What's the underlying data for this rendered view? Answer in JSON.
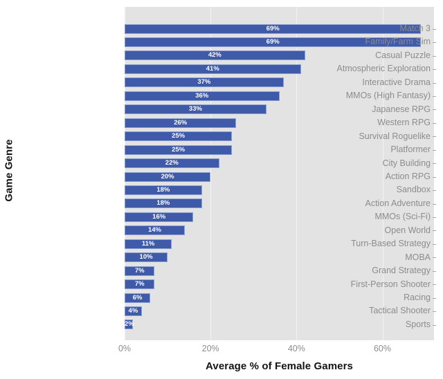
{
  "chart_data": {
    "type": "bar",
    "orientation": "horizontal",
    "title": "",
    "xlabel": "Average % of Female Gamers",
    "ylabel": "Game Genre",
    "xlim": [
      0,
      72
    ],
    "xticks": [
      "0%",
      "20%",
      "40%",
      "60%"
    ],
    "xtick_values": [
      0,
      20,
      40,
      60
    ],
    "grid": true,
    "legend": null,
    "bar_color": "#3f5aa9",
    "panel_color": "#e3e3e3",
    "gridline_color": "#f2f2f2",
    "label_color": "#8c8c8c",
    "value_label_color": "#ffffff",
    "categories": [
      "Match 3",
      "Family/Farm Sim",
      "Casual Puzzle",
      "Atmospheric Exploration",
      "Interactive Drama",
      "MMOs (High Fantasy)",
      "Japanese RPG",
      "Western RPG",
      "Survival Roguelike",
      "Platformer",
      "City Building",
      "Action RPG",
      "Sandbox",
      "Action Adventure",
      "MMOs (Sci-Fi)",
      "Open World",
      "Turn-Based Strategy",
      "MOBA",
      "Grand Strategy",
      "First-Person Shooter",
      "Racing",
      "Tactical Shooter",
      "Sports"
    ],
    "values": [
      69,
      69,
      42,
      41,
      37,
      36,
      33,
      26,
      25,
      25,
      22,
      20,
      18,
      18,
      16,
      14,
      11,
      10,
      7,
      7,
      6,
      4,
      2
    ],
    "value_labels": [
      "69%",
      "69%",
      "42%",
      "41%",
      "37%",
      "36%",
      "33%",
      "26%",
      "25%",
      "25%",
      "22%",
      "20%",
      "18%",
      "18%",
      "16%",
      "14%",
      "11%",
      "10%",
      "7%",
      "7%",
      "6%",
      "4%",
      "2%"
    ]
  }
}
